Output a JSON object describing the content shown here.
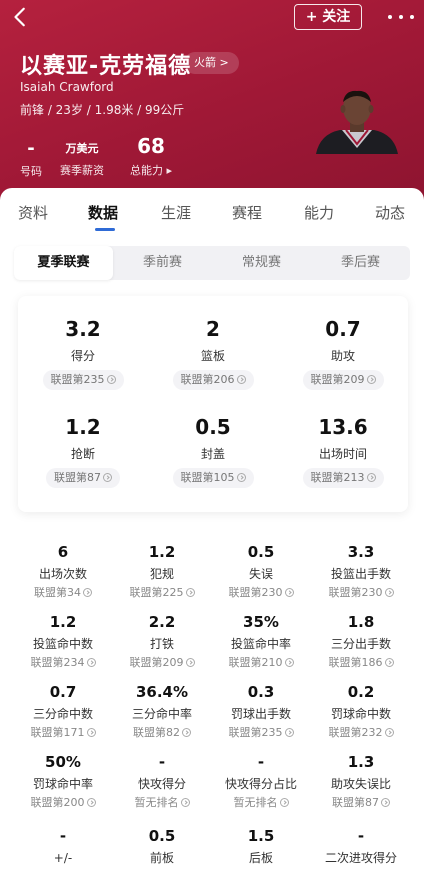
{
  "header": {
    "follow_label": "+ 关注",
    "player_name_cn": "以赛亚-克劳福德",
    "team_tag": "火箭 >",
    "player_name_en": "Isaiah Crawford",
    "bio": "前锋 / 23岁 / 1.98米 / 99公斤",
    "number": {
      "value": "-",
      "label": "号码"
    },
    "salary": {
      "value": "万美元",
      "label": "赛季薪资"
    },
    "rating": {
      "value": "68",
      "label": "总能力 ▸"
    }
  },
  "tabs": [
    "资料",
    "数据",
    "生涯",
    "赛程",
    "能力",
    "动态"
  ],
  "active_tab": "数据",
  "seasons": [
    "夏季联赛",
    "季前赛",
    "常规赛",
    "季后赛"
  ],
  "active_season": "夏季联赛",
  "main_stats": [
    {
      "value": "3.2",
      "label": "得分",
      "rank": "联盟第235"
    },
    {
      "value": "2",
      "label": "篮板",
      "rank": "联盟第206"
    },
    {
      "value": "0.7",
      "label": "助攻",
      "rank": "联盟第209"
    },
    {
      "value": "1.2",
      "label": "抢断",
      "rank": "联盟第87"
    },
    {
      "value": "0.5",
      "label": "封盖",
      "rank": "联盟第105"
    },
    {
      "value": "13.6",
      "label": "出场时间",
      "rank": "联盟第213"
    }
  ],
  "detail_stats": [
    {
      "value": "6",
      "label": "出场次数",
      "rank": "联盟第34"
    },
    {
      "value": "1.2",
      "label": "犯规",
      "rank": "联盟第225"
    },
    {
      "value": "0.5",
      "label": "失误",
      "rank": "联盟第230"
    },
    {
      "value": "3.3",
      "label": "投篮出手数",
      "rank": "联盟第230"
    },
    {
      "value": "1.2",
      "label": "投篮命中数",
      "rank": "联盟第234"
    },
    {
      "value": "2.2",
      "label": "打铁",
      "rank": "联盟第209"
    },
    {
      "value": "35%",
      "label": "投篮命中率",
      "rank": "联盟第210"
    },
    {
      "value": "1.8",
      "label": "三分出手数",
      "rank": "联盟第186"
    },
    {
      "value": "0.7",
      "label": "三分命中数",
      "rank": "联盟第171"
    },
    {
      "value": "36.4%",
      "label": "三分命中率",
      "rank": "联盟第82"
    },
    {
      "value": "0.3",
      "label": "罚球出手数",
      "rank": "联盟第235"
    },
    {
      "value": "0.2",
      "label": "罚球命中数",
      "rank": "联盟第232"
    },
    {
      "value": "50%",
      "label": "罚球命中率",
      "rank": "联盟第200"
    },
    {
      "value": "-",
      "label": "快攻得分",
      "rank": "暂无排名"
    },
    {
      "value": "-",
      "label": "快攻得分占比",
      "rank": "暂无排名"
    },
    {
      "value": "1.3",
      "label": "助攻失误比",
      "rank": "联盟第87"
    },
    {
      "value": "-",
      "label": "+/-",
      "rank": ""
    },
    {
      "value": "0.5",
      "label": "前板",
      "rank": ""
    },
    {
      "value": "1.5",
      "label": "后板",
      "rank": ""
    },
    {
      "value": "-",
      "label": "二次进攻得分",
      "rank": ""
    }
  ],
  "colors": {
    "header_bg": "#a61a38",
    "tab_indicator": "#2f6bd6"
  },
  "icons": [
    "back-arrow-icon",
    "more-dots-icon",
    "rank-info-icon"
  ]
}
